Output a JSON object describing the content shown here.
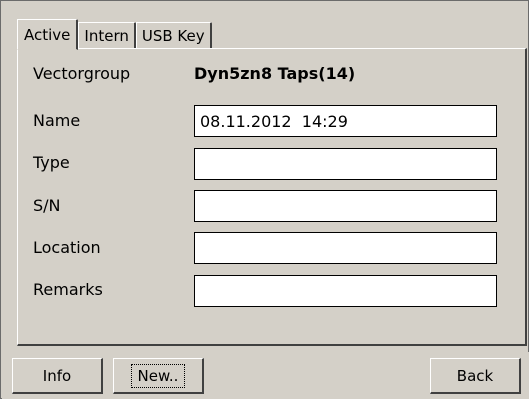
{
  "tabs": [
    {
      "label": "Active",
      "active": true
    },
    {
      "label": "Intern",
      "active": false
    },
    {
      "label": "USB Key",
      "active": false
    }
  ],
  "form": {
    "vectorgroup_label": "Vectorgroup",
    "vectorgroup_value": "Dyn5zn8 Taps(14)",
    "name_label": "Name",
    "name_value": "08.11.2012  14:29",
    "type_label": "Type",
    "type_value": "",
    "sn_label": "S/N",
    "sn_value": "",
    "location_label": "Location",
    "location_value": "",
    "remarks_label": "Remarks",
    "remarks_value": ""
  },
  "buttons": {
    "info": "Info",
    "new": "New..",
    "back": "Back"
  }
}
